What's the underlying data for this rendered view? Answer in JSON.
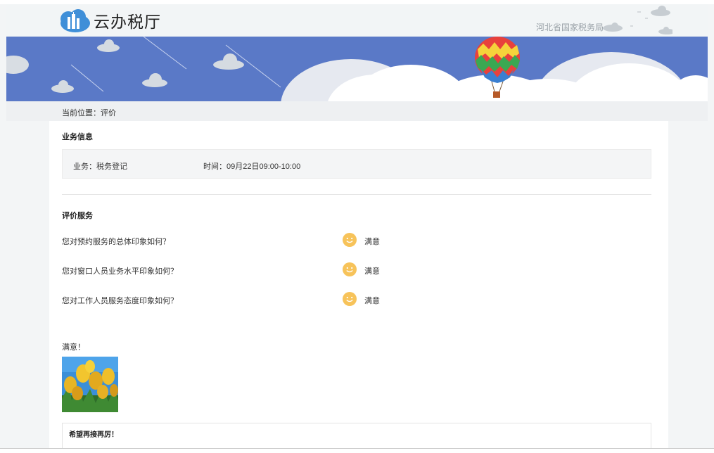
{
  "header": {
    "app_title": "云办税厅",
    "bureau": "河北省国家税务局"
  },
  "breadcrumb": {
    "text": "当前位置：评价"
  },
  "business_info": {
    "section_title": "业务信息",
    "business": "业务：税务登记",
    "time": "时间：09月22日09:00-10:00"
  },
  "evaluation": {
    "section_title": "评价服务",
    "questions": [
      {
        "question": "您对预约服务的总体印象如何？",
        "answer": "满意",
        "icon": "smiley-face-icon"
      },
      {
        "question": "您对窗口人员业务水平印象如何？",
        "answer": "满意",
        "icon": "smiley-face-icon"
      },
      {
        "question": "您对工作人员服务态度印象如何？",
        "answer": "满意",
        "icon": "smiley-face-icon"
      }
    ]
  },
  "comment": {
    "label": "满意！",
    "feedback": "希望再接再厉！"
  },
  "colors": {
    "banner": "#5a79c7",
    "smiley": "#f7c35a",
    "background": "#f3f5f6"
  }
}
